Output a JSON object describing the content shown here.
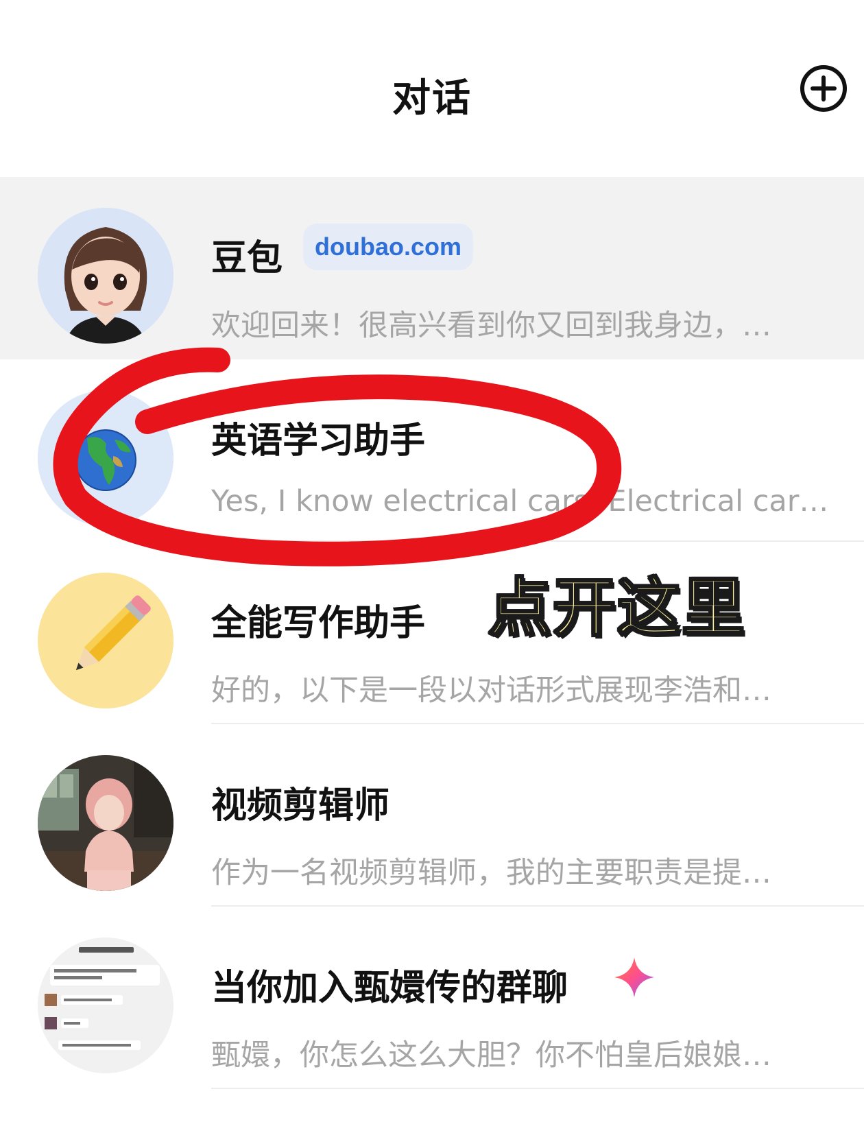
{
  "header": {
    "title": "对话",
    "new_icon": "plus-circle-icon"
  },
  "conversations": [
    {
      "name": "豆包",
      "badge": "doubao.com",
      "preview": "欢迎回来！很高兴看到你又回到我身边，…",
      "avatar": "doubao-girl-avatar",
      "active": true
    },
    {
      "name": "英语学习助手",
      "preview": "Yes, I know electrical cars. Electrical cars…",
      "avatar": "globe-icon"
    },
    {
      "name": "全能写作助手",
      "preview": "好的，以下是一段以对话形式展现李浩和…",
      "avatar": "pencil-icon"
    },
    {
      "name": "视频剪辑师",
      "preview": "作为一名视频剪辑师，我的主要职责是提…",
      "avatar": "photo-avatar"
    },
    {
      "name": "当你加入甄嬛传的群聊",
      "preview": "甄嬛，你怎么这么大胆？你不怕皇后娘娘…",
      "avatar": "chat-screenshot-avatar",
      "badge_icon": "sparkle-icon"
    }
  ],
  "annotation": {
    "text": "点开这里",
    "ring_color": "#e8141b",
    "text_color": "#fdef9a"
  },
  "colors": {
    "active_row": "#f2f2f2",
    "badge_bg": "#e6ecf7",
    "badge_text": "#2e6fd8",
    "preview_text": "#a5a5a5"
  }
}
